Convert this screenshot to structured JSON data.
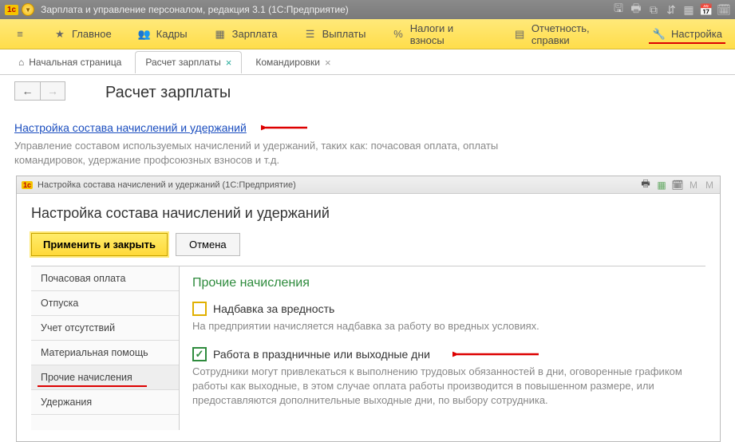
{
  "titlebar": {
    "title": "Зарплата и управление персоналом, редакция 3.1  (1С:Предприятие)"
  },
  "mainmenu": {
    "items": [
      {
        "label": "Главное"
      },
      {
        "label": "Кадры"
      },
      {
        "label": "Зарплата"
      },
      {
        "label": "Выплаты"
      },
      {
        "label": "Налоги и взносы"
      },
      {
        "label": "Отчетность, справки"
      },
      {
        "label": "Настройка"
      }
    ]
  },
  "tabs": {
    "home": "Начальная страница",
    "t1": "Расчет зарплаты",
    "t2": "Командировки"
  },
  "page": {
    "title": "Расчет зарплаты",
    "link": "Настройка состава начислений и удержаний",
    "desc": "Управление составом используемых начислений и удержаний, таких как: почасовая оплата, оплаты командировок, удержание профсоюзных взносов и т.д."
  },
  "subwindow": {
    "title": "Настройка состава начислений и удержаний  (1С:Предприятие)",
    "heading": "Настройка состава начислений и удержаний",
    "apply": "Применить и закрыть",
    "cancel": "Отмена",
    "sidebar": [
      "Почасовая оплата",
      "Отпуска",
      "Учет отсутствий",
      "Материальная помощь",
      "Прочие начисления",
      "Удержания"
    ],
    "panel": {
      "title": "Прочие начисления",
      "chk1_label": "Надбавка за вредность",
      "chk1_desc": "На предприятии начисляется надбавка за работу во вредных условиях.",
      "chk2_label": "Работа в праздничные или выходные дни",
      "chk2_desc": "Сотрудники могут привлекаться к выполнению трудовых обязанностей в дни, оговоренные графиком работы как выходные, в этом случае оплата работы производится в повышенном размере, или предоставляются дополнительные выходные дни, по выбору сотрудника."
    }
  }
}
